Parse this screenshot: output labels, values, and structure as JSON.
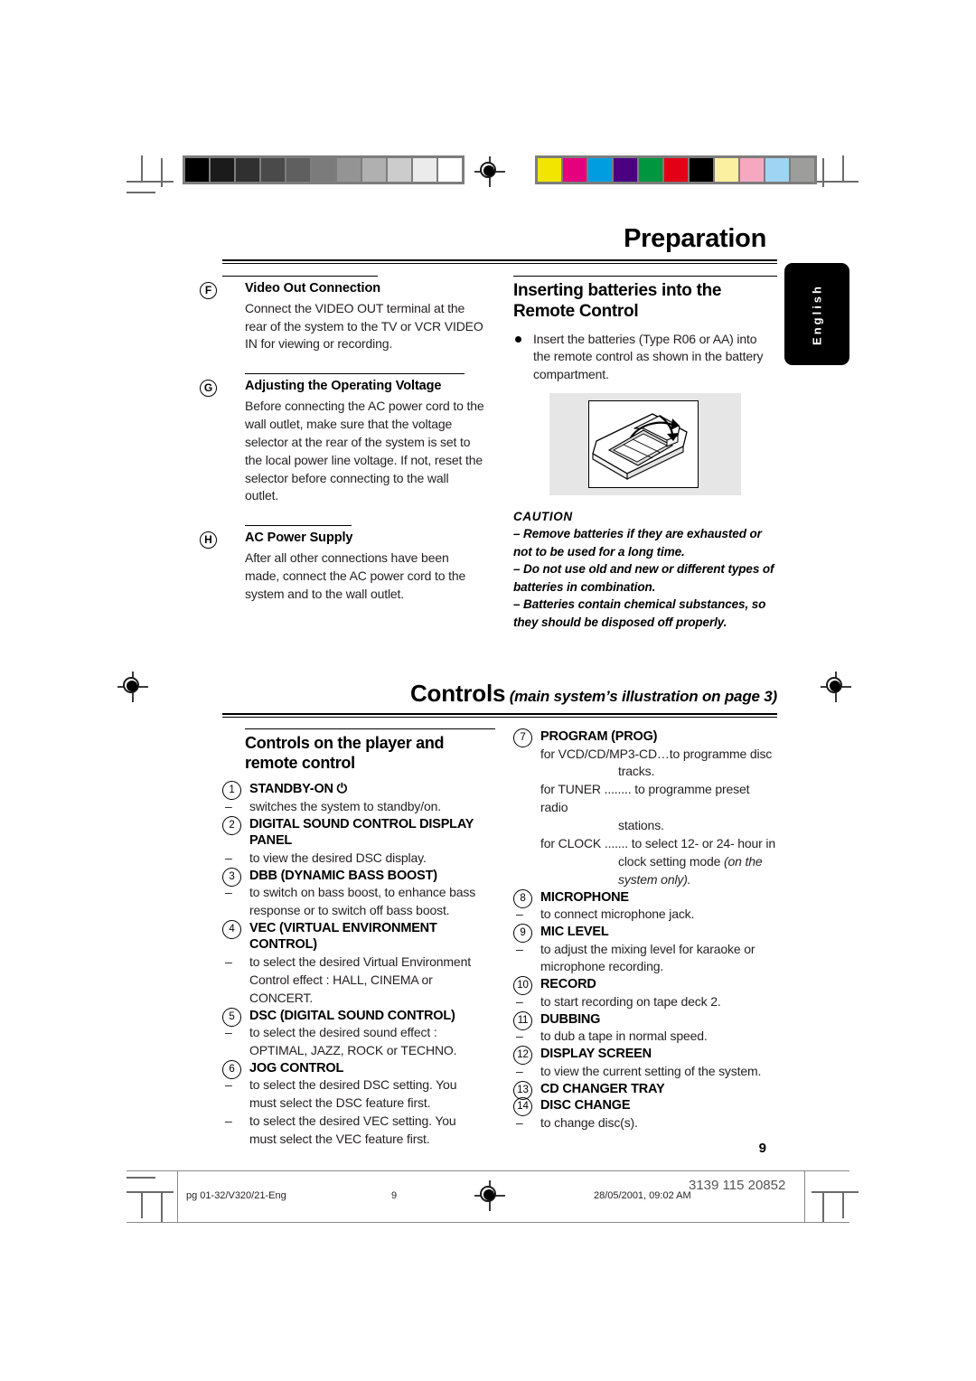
{
  "document": {
    "chapter_title": "Preparation",
    "language_tab": "English",
    "page_number": "9"
  },
  "left_column": {
    "sections": [
      {
        "letter": "F",
        "heading": "Video Out Connection",
        "body": "Connect the VIDEO OUT terminal at the rear of the system to the TV or VCR VIDEO IN for viewing or recording."
      },
      {
        "letter": "G",
        "heading": "Adjusting the Operating Voltage",
        "body": "Before connecting the AC power cord to the wall outlet, make sure that the voltage selector at the rear of the system is set to the local power line voltage. If not, reset the selector before connecting to the wall outlet."
      },
      {
        "letter": "H",
        "heading": "AC Power Supply",
        "body": "After all other connections have been made, connect the AC power cord to the system and to the wall outlet."
      }
    ]
  },
  "right_column": {
    "heading_line1": "Inserting batteries into the",
    "heading_line2": "Remote Control",
    "bullet": "Insert the batteries (Type R06 or AA) into the remote control as shown in the battery compartment.",
    "figure_name": "remote-control-battery-compartment-illustration",
    "caution": {
      "title": "CAUTION",
      "lines": [
        "–  Remove batteries if they are exhausted or not to be used for a long time.",
        "–  Do not use old and new or different types of batteries in combination.",
        "–  Batteries contain chemical substances, so they should be disposed off properly."
      ]
    }
  },
  "controls_banner": {
    "main": "Controls",
    "sub": "(main system’s illustration on page 3)"
  },
  "controls": {
    "section_heading_line1": "Controls on the player and",
    "section_heading_line2": "remote control",
    "left_items": [
      {
        "num": "1",
        "label": "STANDBY-ON",
        "symbol": "⏻",
        "descriptions": [
          "switches the system to standby/on."
        ]
      },
      {
        "num": "2",
        "label": "DIGITAL SOUND CONTROL DISPLAY PANEL",
        "descriptions": [
          "to view the desired DSC display."
        ]
      },
      {
        "num": "3",
        "label": "DBB (DYNAMIC BASS BOOST)",
        "descriptions": [
          "to switch on bass boost, to enhance bass response or to switch off bass boost."
        ]
      },
      {
        "num": "4",
        "label": "VEC (VIRTUAL ENVIRONMENT CONTROL)",
        "descriptions": [
          "to select the desired Virtual Environment Control effect : HALL, CINEMA or CONCERT."
        ]
      },
      {
        "num": "5",
        "label": "DSC (DIGITAL SOUND CONTROL)",
        "descriptions": [
          "to select the desired sound effect : OPTIMAL, JAZZ,  ROCK or TECHNO."
        ]
      },
      {
        "num": "6",
        "label": "JOG CONTROL",
        "descriptions": [
          "to select the desired DSC setting. You must select the DSC feature first.",
          "to select the desired VEC setting. You must select the VEC feature first."
        ]
      }
    ],
    "right_items": [
      {
        "num": "7",
        "label": "PROGRAM (PROG)",
        "program_lines": [
          {
            "lead": "for VCD/CD/MP3-CD…",
            "text": "to programme disc",
            "indent": "tracks."
          },
          {
            "lead": "for TUNER ........",
            "text": "to programme preset radio",
            "indent": "stations."
          },
          {
            "lead": "for CLOCK .......",
            "text": "to select 12- or 24-  hour in",
            "indent": "clock setting mode",
            "indent_italic": "(on the",
            "indent_italic2": "system only)."
          }
        ]
      },
      {
        "num": "8",
        "label": "MICROPHONE",
        "descriptions": [
          "to connect microphone jack."
        ]
      },
      {
        "num": "9",
        "label": "MIC LEVEL",
        "descriptions": [
          "to adjust the mixing level for karaoke or microphone recording."
        ]
      },
      {
        "num": "10",
        "label": "RECORD",
        "descriptions": [
          "to start recording on tape deck 2."
        ]
      },
      {
        "num": "11",
        "label": "DUBBING",
        "descriptions": [
          "to dub a tape in normal speed."
        ]
      },
      {
        "num": "12",
        "label": "DISPLAY SCREEN",
        "descriptions": [
          "to view the current setting of the system."
        ]
      },
      {
        "num": "13",
        "label": "CD CHANGER TRAY",
        "descriptions": []
      },
      {
        "num": "14",
        "label": "DISC CHANGE",
        "descriptions": [
          "to change disc(s)."
        ]
      }
    ]
  },
  "footer": {
    "file_ref": "pg 01-32/V320/21-Eng",
    "page_marker": "9",
    "timestamp": "28/05/2001, 09:02 AM",
    "publication_code": "3139 115 20852"
  },
  "print_marks": {
    "grayscale_swatches": [
      "#000000",
      "#1b1b1b",
      "#303030",
      "#4a4a4a",
      "#5f5f5f",
      "#7b7b7b",
      "#949494",
      "#b0b0b0",
      "#cccccc",
      "#ebebeb",
      "#ffffff"
    ],
    "color_swatches": [
      "#f2e500",
      "#e5007d",
      "#009ee0",
      "#4b0082",
      "#009640",
      "#e30016",
      "#000000",
      "#faf0a0",
      "#f5a8c0",
      "#9fd4f2",
      "#9d9d9c"
    ]
  }
}
